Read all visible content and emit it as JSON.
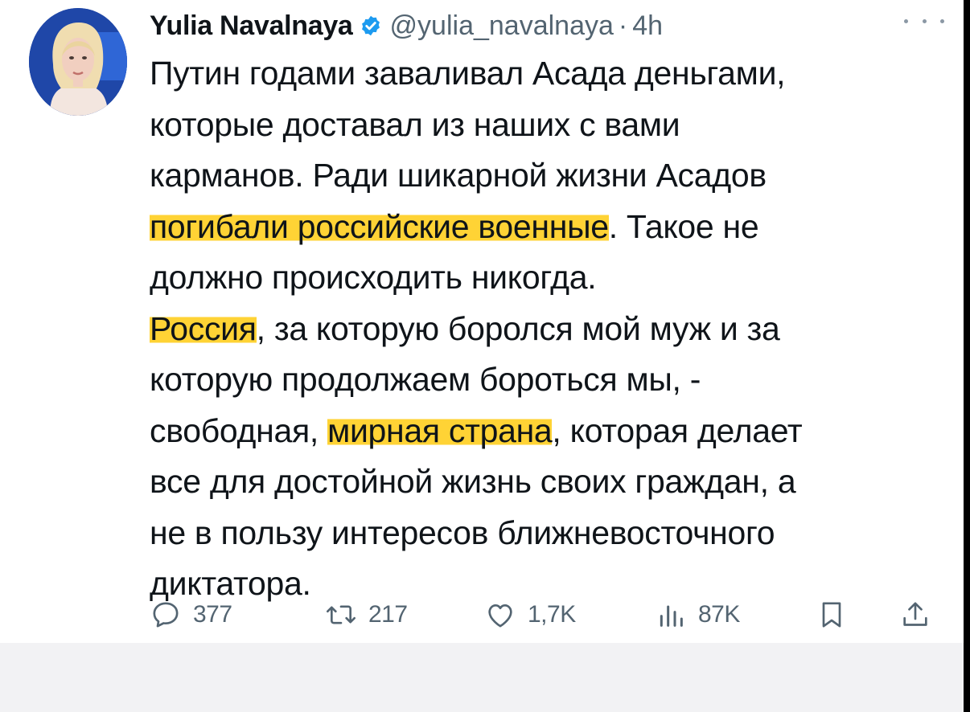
{
  "author": {
    "name": "Yulia Navalnaya",
    "handle": "@yulia_navalnaya",
    "separator": "·",
    "time": "4h"
  },
  "tweet": {
    "lines": [
      "Путин годами заваливал Асада деньгами,",
      "которые доставал из наших с вами",
      "карманов. Ради шикарной жизни Асадов",
      "погибали российские военные",
      ". Такое не",
      "должно происходить никогда.",
      "Россия",
      ", за которую боролся мой муж и за",
      "которую продолжаем бороться мы, -",
      "свободная, ",
      "мирная страна",
      ", которая делает",
      "все для достойной жизнь своих граждан, а",
      "не в пользу интересов ближневосточного",
      "диктатора."
    ]
  },
  "actions": {
    "replies": "377",
    "retweets": "217",
    "likes": "1,7K",
    "views": "87K"
  },
  "icons": {
    "verified": "verified-badge-icon",
    "more": "more-icon",
    "reply": "reply-icon",
    "retweet": "retweet-icon",
    "like": "like-icon",
    "views": "views-icon",
    "bookmark": "bookmark-icon",
    "share": "share-icon"
  },
  "colors": {
    "verified": "#1d9bf0",
    "highlight": "#ffd335",
    "text": "#0f1419",
    "muted": "#536471"
  }
}
